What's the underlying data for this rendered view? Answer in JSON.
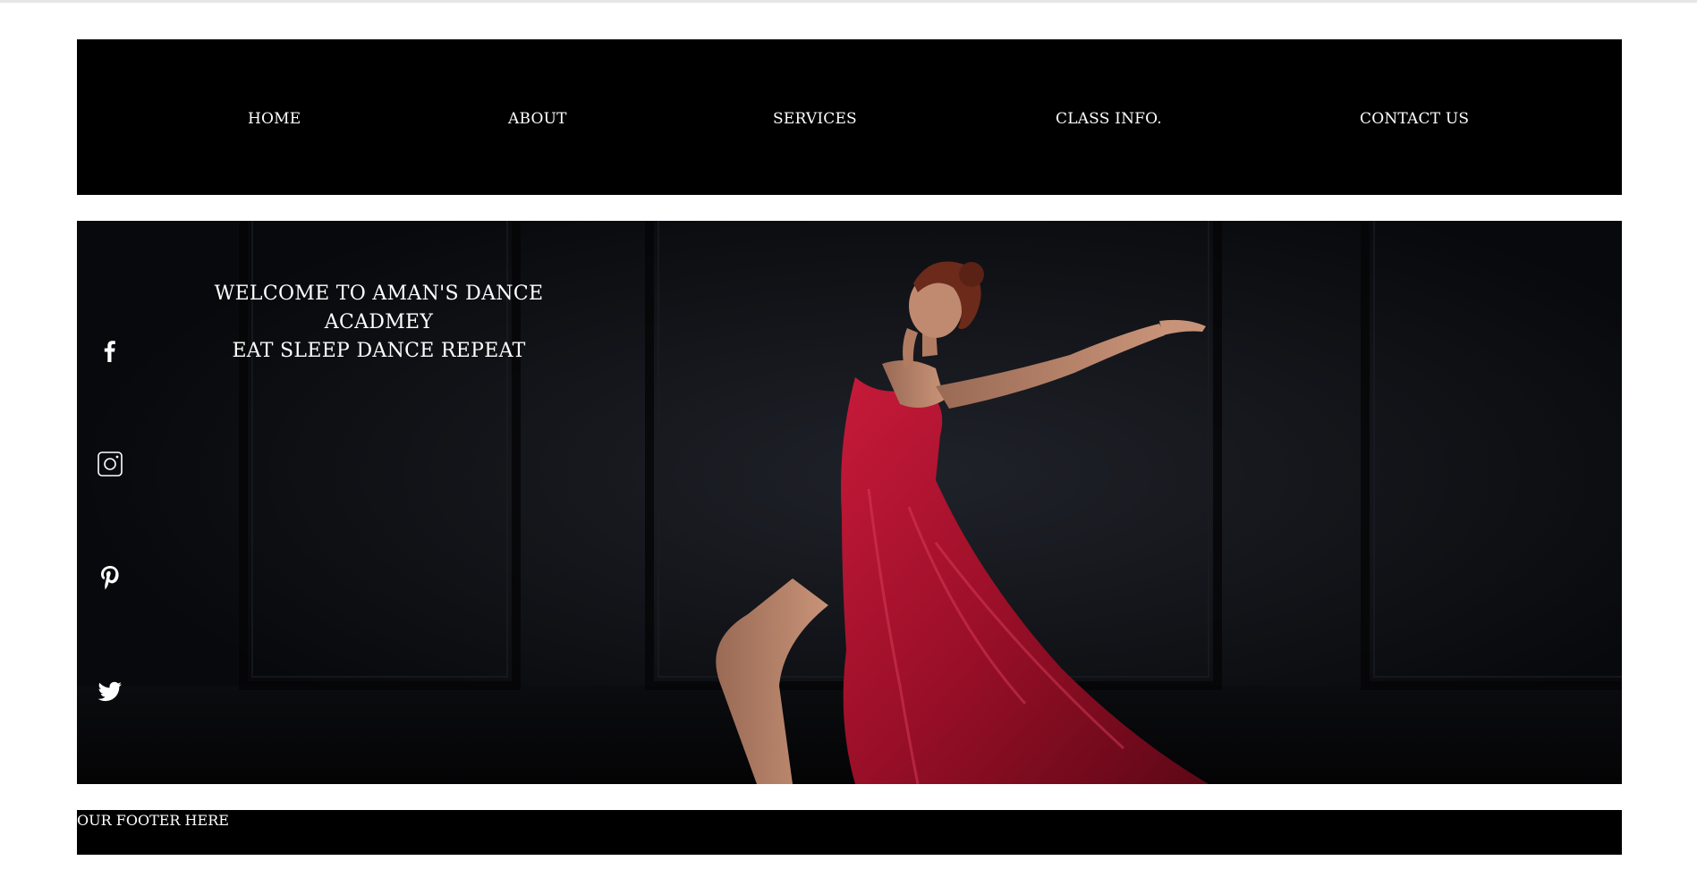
{
  "nav": {
    "items": [
      {
        "label": "HOME"
      },
      {
        "label": "ABOUT"
      },
      {
        "label": "SERVICES"
      },
      {
        "label": "CLASS INFO."
      },
      {
        "label": "CONTACT US"
      }
    ]
  },
  "hero": {
    "line1": "WELCOME TO AMAN'S DANCE ACADMEY",
    "line2": "EAT SLEEP DANCE REPEAT",
    "image_subject": "dancer in red satin dress against dark paneled wall",
    "social_icons": [
      "facebook-icon",
      "instagram-icon",
      "pinterest-icon",
      "twitter-icon"
    ]
  },
  "footer": {
    "text": "OUR FOOTER HERE"
  },
  "colors": {
    "nav_bg": "#000000",
    "hero_bg": "#0c0d11",
    "dress": "#a3122c",
    "text": "#ffffff"
  }
}
